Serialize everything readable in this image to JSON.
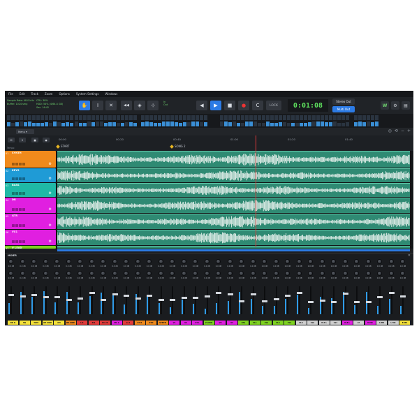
{
  "menu": [
    "File",
    "Edit",
    "Track",
    "Zoom",
    "Options",
    "System Settings",
    "Windows"
  ],
  "info": {
    "line1": "Sample Rate: 48.0 kHz",
    "line2": "Buffer: 1024 smp",
    "cpu": "CPU: 38%",
    "hdd": "HDD: 54%   (4/64.4 GB)",
    "lat": "Sec: 16:42"
  },
  "inout": {
    "in": "In",
    "out": "Out"
  },
  "transport": {
    "buttons": [
      "◀",
      "▶",
      "■",
      "●",
      "C"
    ],
    "lock": "LOCK",
    "time": "0:01:08",
    "stereo_out": "Stereo Out",
    "multi_out": "Multi Out"
  },
  "tools": [
    "✋",
    "I",
    "✕",
    "◀◀",
    "◈",
    "⊹"
  ],
  "toolbar2": {
    "menu_label": "Menu ▾"
  },
  "ruler": {
    "buttons": [
      "M",
      "S",
      "■",
      "●"
    ],
    "ticks": [
      "00:00",
      "00:20",
      "00:40",
      "01:00",
      "01:20",
      "01:40"
    ],
    "markers": [
      "START",
      "SONG 2"
    ],
    "tempo_label": "Tempo"
  },
  "tracks": [
    {
      "num": "01",
      "name": "SYNTH",
      "color": "#f08a1c"
    },
    {
      "num": "02",
      "name": "KEYS",
      "color": "#1f9bd6"
    },
    {
      "num": "03",
      "name": "BASS",
      "color": "#1fb9a6"
    },
    {
      "num": "04",
      "name": "DR",
      "color": "#e01fe0"
    },
    {
      "num": "05",
      "name": "GTR",
      "color": "#e01fe0"
    },
    {
      "num": "06",
      "name": "VX1",
      "color": "#e01fe0"
    },
    {
      "num": "07",
      "name": "V LEAD",
      "color": "#7ed321"
    }
  ],
  "mixer": {
    "title": "MIXER",
    "close": "✕",
    "channels": [
      {
        "label": "BD D",
        "color": "#f5e23a"
      },
      {
        "label": "SN",
        "color": "#f5e23a"
      },
      {
        "label": "TOM",
        "color": "#f5e23a"
      },
      {
        "label": "OH SIDE",
        "color": "#f5e23a"
      },
      {
        "label": "OH",
        "color": "#f5e23a"
      },
      {
        "label": "BD SIDE",
        "color": "#f08a1c"
      },
      {
        "label": "LI1",
        "color": "#e23b3b"
      },
      {
        "label": "RI1",
        "color": "#e23b3b"
      },
      {
        "label": "BC 2S",
        "color": "#e23b3b"
      },
      {
        "label": "MC 2",
        "color": "#e01fe0"
      },
      {
        "label": "LI 2",
        "color": "#e23b3b"
      },
      {
        "label": "KY R",
        "color": "#f08a1c"
      },
      {
        "label": "SYN",
        "color": "#f08a1c"
      },
      {
        "label": "SYNTH",
        "color": "#f08a1c"
      },
      {
        "label": "V1",
        "color": "#e01fe0"
      },
      {
        "label": "V2",
        "color": "#e01fe0"
      },
      {
        "label": "V3 L",
        "color": "#e01fe0"
      },
      {
        "label": "V LEAD",
        "color": "#7ed321"
      },
      {
        "label": "VX",
        "color": "#e01fe0"
      },
      {
        "label": "V4",
        "color": "#e01fe0"
      },
      {
        "label": "VA1",
        "color": "#7ed321"
      },
      {
        "label": "VL1",
        "color": "#7ed321"
      },
      {
        "label": "VL2",
        "color": "#7ed321"
      },
      {
        "label": "VL3",
        "color": "#7ed321"
      },
      {
        "label": "VL4",
        "color": "#7ed321"
      },
      {
        "label": "VL5",
        "color": "#cfcfcf"
      },
      {
        "label": "VL6",
        "color": "#cfcfcf"
      },
      {
        "label": "VL6 L",
        "color": "#cfcfcf"
      },
      {
        "label": "VL7",
        "color": "#cfcfcf"
      },
      {
        "label": "VL8 L",
        "color": "#e01fe0"
      },
      {
        "label": "LT",
        "color": "#cfcfcf"
      },
      {
        "label": "K MX",
        "color": "#e01fe0"
      },
      {
        "label": "G MX",
        "color": "#cfcfcf"
      },
      {
        "label": "L MX",
        "color": "#cfcfcf"
      },
      {
        "label": "B MX",
        "color": "#f5e23a"
      }
    ]
  },
  "colors": {
    "accent": "#2c7be5",
    "time": "#5ee05e",
    "wave_bg": "#2f8a73",
    "wave": "#e8f2ee"
  }
}
